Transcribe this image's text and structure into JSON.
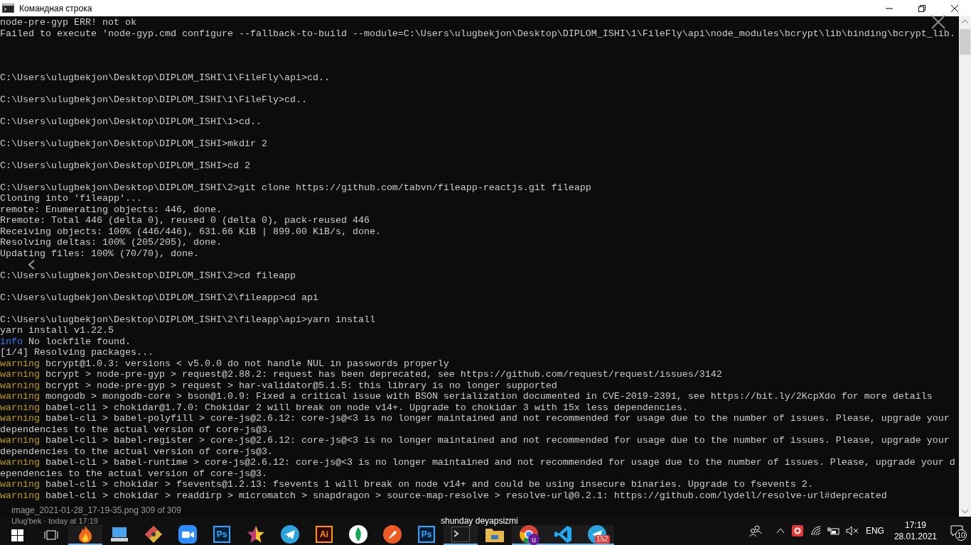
{
  "window": {
    "title": "Командная строка"
  },
  "terminal_lines": [
    {
      "kind": "plain",
      "text": "node-pre-gyp ERR! not ok"
    },
    {
      "kind": "plain",
      "text": "Failed to execute 'node-gyp.cmd configure --fallback-to-build --module=C:\\Users\\ulugbekjon\\Desktop\\DIPLOM_ISHI\\1\\FileFly\\api\\node_modules\\bcrypt\\lib\\binding\\bcrypt_lib."
    },
    {
      "kind": "blank"
    },
    {
      "kind": "blank"
    },
    {
      "kind": "blank"
    },
    {
      "kind": "plain",
      "text": "C:\\Users\\ulugbekjon\\Desktop\\DIPLOM_ISHI\\1\\FileFly\\api>cd.."
    },
    {
      "kind": "blank"
    },
    {
      "kind": "plain",
      "text": "C:\\Users\\ulugbekjon\\Desktop\\DIPLOM_ISHI\\1\\FileFly>cd.."
    },
    {
      "kind": "blank"
    },
    {
      "kind": "plain",
      "text": "C:\\Users\\ulugbekjon\\Desktop\\DIPLOM_ISHI\\1>cd.."
    },
    {
      "kind": "blank"
    },
    {
      "kind": "plain",
      "text": "C:\\Users\\ulugbekjon\\Desktop\\DIPLOM_ISHI>mkdir 2"
    },
    {
      "kind": "blank"
    },
    {
      "kind": "plain",
      "text": "C:\\Users\\ulugbekjon\\Desktop\\DIPLOM_ISHI>cd 2"
    },
    {
      "kind": "blank"
    },
    {
      "kind": "plain",
      "text": "C:\\Users\\ulugbekjon\\Desktop\\DIPLOM_ISHI\\2>git clone https://github.com/tabvn/fileapp-reactjs.git fileapp"
    },
    {
      "kind": "plain",
      "text": "Cloning into 'fileapp'..."
    },
    {
      "kind": "plain",
      "text": "remote: Enumerating objects: 446, done."
    },
    {
      "kind": "plain",
      "text": "Rremote: Total 446 (delta 0), reused 0 (delta 0), pack-reused 446"
    },
    {
      "kind": "plain",
      "text": "Receiving objects: 100% (446/446), 631.66 KiB | 899.00 KiB/s, done."
    },
    {
      "kind": "plain",
      "text": "Resolving deltas: 100% (205/205), done."
    },
    {
      "kind": "plain",
      "text": "Updating files: 100% (70/70), done."
    },
    {
      "kind": "blank"
    },
    {
      "kind": "plain",
      "text": "C:\\Users\\ulugbekjon\\Desktop\\DIPLOM_ISHI\\2>cd fileapp"
    },
    {
      "kind": "blank"
    },
    {
      "kind": "plain",
      "text": "C:\\Users\\ulugbekjon\\Desktop\\DIPLOM_ISHI\\2\\fileapp>cd api"
    },
    {
      "kind": "blank"
    },
    {
      "kind": "plain",
      "text": "C:\\Users\\ulugbekjon\\Desktop\\DIPLOM_ISHI\\2\\fileapp\\api>yarn install"
    },
    {
      "kind": "plain",
      "text": "yarn install v1.22.5"
    },
    {
      "kind": "info",
      "tag": "info",
      "text": "No lockfile found."
    },
    {
      "kind": "plain",
      "text": "[1/4] Resolving packages..."
    },
    {
      "kind": "warning",
      "tag": "warning",
      "text": "bcrypt@1.0.3: versions < v5.0.0 do not handle NUL in passwords properly"
    },
    {
      "kind": "warning",
      "tag": "warning",
      "text": "bcrypt > node-pre-gyp > request@2.88.2: request has been deprecated, see https://github.com/request/request/issues/3142"
    },
    {
      "kind": "warning",
      "tag": "warning",
      "text": "bcrypt > node-pre-gyp > request > har-validator@5.1.5: this library is no longer supported"
    },
    {
      "kind": "warning",
      "tag": "warning",
      "text": "mongodb > mongodb-core > bson@1.0.9: Fixed a critical issue with BSON serialization documented in CVE-2019-2391, see https://bit.ly/2KcpXdo for more details"
    },
    {
      "kind": "warning",
      "tag": "warning",
      "text": "babel-cli > chokidar@1.7.0: Chokidar 2 will break on node v14+. Upgrade to chokidar 3 with 15x less dependencies."
    },
    {
      "kind": "warning",
      "tag": "warning",
      "text": "babel-cli > babel-polyfill > core-js@2.6.12: core-js@<3 is no longer maintained and not recommended for usage due to the number of issues. Please, upgrade your"
    },
    {
      "kind": "plain",
      "text": "dependencies to the actual version of core-js@3."
    },
    {
      "kind": "warning",
      "tag": "warning",
      "text": "babel-cli > babel-register > core-js@2.6.12: core-js@<3 is no longer maintained and not recommended for usage due to the number of issues. Please, upgrade your"
    },
    {
      "kind": "plain",
      "text": "dependencies to the actual version of core-js@3."
    },
    {
      "kind": "warning",
      "tag": "warning",
      "text": "babel-cli > babel-runtime > core-js@2.6.12: core-js@<3 is no longer maintained and not recommended for usage due to the number of issues. Please, upgrade your d"
    },
    {
      "kind": "plain",
      "text": "ependencies to the actual version of core-js@3."
    },
    {
      "kind": "warning",
      "tag": "warning",
      "text": "babel-cli > chokidar > fsevents@1.2.13: fsevents 1 will break on node v14+ and could be using insecure binaries. Upgrade to fsevents 2."
    },
    {
      "kind": "warning",
      "tag": "warning",
      "text": "babel-cli > chokidar > readdirp > micromatch > snapdragon > source-map-resolve > resolve-url@0.2.1: https://github.com/lydell/resolve-url#deprecated"
    }
  ],
  "image_viewer": {
    "file_caption": "image_2021-01-28_17-19-35.png 309 of 309",
    "author_caption": "Ulug'bek · today at 17:19"
  },
  "taskbar": {
    "apps": [
      {
        "kind": "fire",
        "running": true
      },
      {
        "kind": "computer",
        "running": false
      },
      {
        "kind": "git",
        "running": false
      },
      {
        "kind": "zoom",
        "running": false
      },
      {
        "kind": "photoshop",
        "label": "Ps",
        "running": false
      },
      {
        "kind": "star",
        "running": false
      },
      {
        "kind": "telegram",
        "running": false
      },
      {
        "kind": "illustrator",
        "label": "Ai",
        "running": false
      },
      {
        "kind": "mongodb",
        "running": false
      },
      {
        "kind": "postman",
        "running": false
      },
      {
        "kind": "photoshop",
        "label": "Ps",
        "running": false
      },
      {
        "kind": "terminal",
        "running": true
      },
      {
        "kind": "folder",
        "running": false
      },
      {
        "kind": "chrome",
        "badge": "u",
        "running": true
      },
      {
        "kind": "vscode",
        "running": true
      },
      {
        "kind": "telegram",
        "badge": "152",
        "running": true
      }
    ],
    "tooltip": "shunday deyapsizmi",
    "language": "ENG",
    "time": "17:19",
    "date": "28.01.2021",
    "notifications": "10"
  }
}
